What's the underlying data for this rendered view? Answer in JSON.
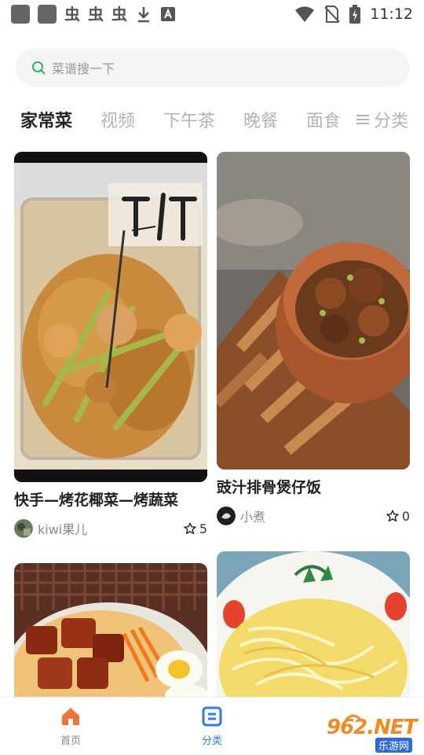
{
  "status_bar": {
    "time": "11:12",
    "left_glyphs": [
      "虫",
      "虫",
      "虫"
    ]
  },
  "search": {
    "placeholder": "菜谱搜一下"
  },
  "tabs": [
    "家常菜",
    "视频",
    "下午茶",
    "晚餐",
    "面食"
  ],
  "active_tab": "家常菜",
  "category_button": "分类",
  "cards": [
    {
      "title": "快手—烤花椰菜—烤蔬菜",
      "author": "kiwi果儿",
      "likes": "5"
    },
    {
      "title": "豉汁排骨煲仔饭",
      "author": "小煮",
      "likes": "0"
    },
    {
      "title": "",
      "author": "",
      "likes": ""
    },
    {
      "title": "",
      "author": "",
      "likes": ""
    }
  ],
  "bottom_nav": [
    {
      "label": "首页",
      "icon": "home-icon"
    },
    {
      "label": "分类",
      "icon": "category-icon"
    }
  ],
  "colors": {
    "accent_blue": "#2f7be8",
    "home_orange": "#f0733c",
    "watermark_orange": "#f08a24"
  },
  "watermark": {
    "text": "962.NET",
    "sub": "乐游网"
  }
}
